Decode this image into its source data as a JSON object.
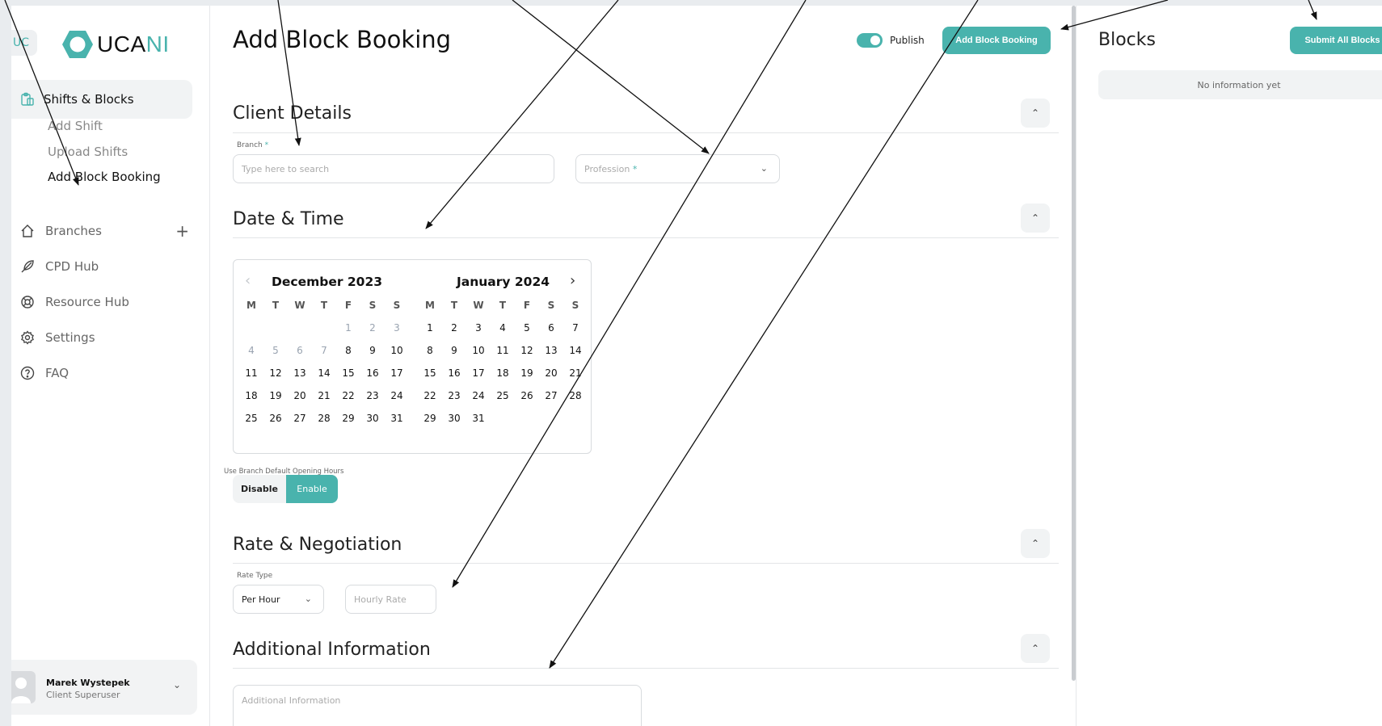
{
  "sidebar": {
    "badge": "UC",
    "logo": {
      "prefix": "UCA",
      "suffix": "NI"
    },
    "primary": {
      "label": "Shifts & Blocks",
      "icon": "clipboard-icon"
    },
    "sub_items": [
      "Add Shift",
      "Upload Shifts",
      "Add Block Booking"
    ],
    "items": [
      {
        "label": "Branches",
        "icon": "home-icon",
        "action": "+"
      },
      {
        "label": "CPD Hub",
        "icon": "feather-icon"
      },
      {
        "label": "Resource Hub",
        "icon": "lifebuoy-icon"
      },
      {
        "label": "Settings",
        "icon": "gear-icon"
      },
      {
        "label": "FAQ",
        "icon": "question-icon"
      }
    ],
    "user": {
      "name": "Marek Wystepek",
      "role": "Client Superuser"
    }
  },
  "main": {
    "title": "Add Block Booking",
    "publish": {
      "label": "Publish",
      "on": true
    },
    "add_button": "Add Block Booking",
    "sections": {
      "client": {
        "title": "Client Details",
        "branch_label": "Branch",
        "required_mark": "*",
        "branch_placeholder": "Type here to search",
        "profession_placeholder": "Profession"
      },
      "datetime": {
        "title": "Date & Time",
        "calendar": {
          "weekdays": [
            "M",
            "T",
            "W",
            "T",
            "F",
            "S",
            "S"
          ],
          "months": [
            {
              "title": "December 2023",
              "rows": [
                [
                  "",
                  "",
                  "",
                  "",
                  "1",
                  "2",
                  "3"
                ],
                [
                  "4",
                  "5",
                  "6",
                  "7",
                  "8",
                  "9",
                  "10"
                ],
                [
                  "11",
                  "12",
                  "13",
                  "14",
                  "15",
                  "16",
                  "17"
                ],
                [
                  "18",
                  "19",
                  "20",
                  "21",
                  "22",
                  "23",
                  "24"
                ],
                [
                  "25",
                  "26",
                  "27",
                  "28",
                  "29",
                  "30",
                  "31"
                ]
              ],
              "disabled": [
                "1",
                "2",
                "3",
                "4",
                "5",
                "6",
                "7"
              ]
            },
            {
              "title": "January 2024",
              "rows": [
                [
                  "1",
                  "2",
                  "3",
                  "4",
                  "5",
                  "6",
                  "7"
                ],
                [
                  "8",
                  "9",
                  "10",
                  "11",
                  "12",
                  "13",
                  "14"
                ],
                [
                  "15",
                  "16",
                  "17",
                  "18",
                  "19",
                  "20",
                  "21"
                ],
                [
                  "22",
                  "23",
                  "24",
                  "25",
                  "26",
                  "27",
                  "28"
                ],
                [
                  "29",
                  "30",
                  "31",
                  "",
                  "",
                  "",
                  ""
                ]
              ],
              "disabled": []
            }
          ]
        },
        "default_hours_label": "Use Branch Default Opening Hours",
        "disable_label": "Disable",
        "enable_label": "Enable",
        "selected": "Enable"
      },
      "rate": {
        "title": "Rate & Negotiation",
        "rate_type_label": "Rate Type",
        "rate_type_value": "Per Hour",
        "hourly_placeholder": "Hourly Rate"
      },
      "additional": {
        "title": "Additional Information",
        "placeholder": "Additional Information"
      }
    }
  },
  "right": {
    "title": "Blocks",
    "submit_button": "Submit All Blocks",
    "empty_text": "No information yet"
  },
  "colors": {
    "accent": "#49b3ad"
  }
}
